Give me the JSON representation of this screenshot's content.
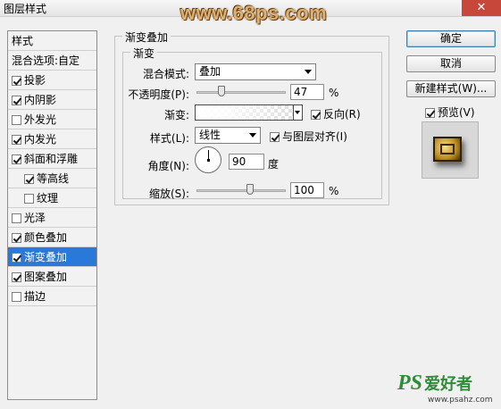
{
  "window": {
    "title": "图层样式",
    "close_glyph": "✕",
    "watermark_top": "www.68ps.com"
  },
  "sidebar": {
    "header": "样式",
    "blend_options": "混合选项:自定",
    "items": [
      {
        "label": "投影",
        "checked": true
      },
      {
        "label": "内阴影",
        "checked": true
      },
      {
        "label": "外发光",
        "checked": false
      },
      {
        "label": "内发光",
        "checked": true
      },
      {
        "label": "斜面和浮雕",
        "checked": true
      },
      {
        "label": "等高线",
        "checked": true,
        "indent": true
      },
      {
        "label": "纹理",
        "checked": false,
        "indent": true
      },
      {
        "label": "光泽",
        "checked": false
      },
      {
        "label": "颜色叠加",
        "checked": true
      },
      {
        "label": "渐变叠加",
        "checked": true,
        "selected": true
      },
      {
        "label": "图案叠加",
        "checked": true
      },
      {
        "label": "描边",
        "checked": false
      }
    ]
  },
  "panel": {
    "outer_legend": "渐变叠加",
    "inner_legend": "渐变",
    "blend_mode_label": "混合模式:",
    "blend_mode_value": "叠加",
    "opacity_label": "不透明度(P):",
    "opacity_value": "47",
    "opacity_unit": "%",
    "gradient_label": "渐变:",
    "reverse_label": "反向(R)",
    "reverse_checked": true,
    "style_label": "样式(L):",
    "style_value": "线性",
    "align_label": "与图层对齐(I)",
    "align_checked": true,
    "angle_label": "角度(N):",
    "angle_value": "90",
    "angle_unit": "度",
    "scale_label": "缩放(S):",
    "scale_value": "100",
    "scale_unit": "%"
  },
  "buttons": {
    "ok": "确定",
    "cancel": "取消",
    "new_style": "新建样式(W)...",
    "preview_label": "预览(V)",
    "preview_checked": true
  },
  "footer": {
    "logo": "PS",
    "logo_cn": "爱好者",
    "url": "www.psahz.com"
  }
}
